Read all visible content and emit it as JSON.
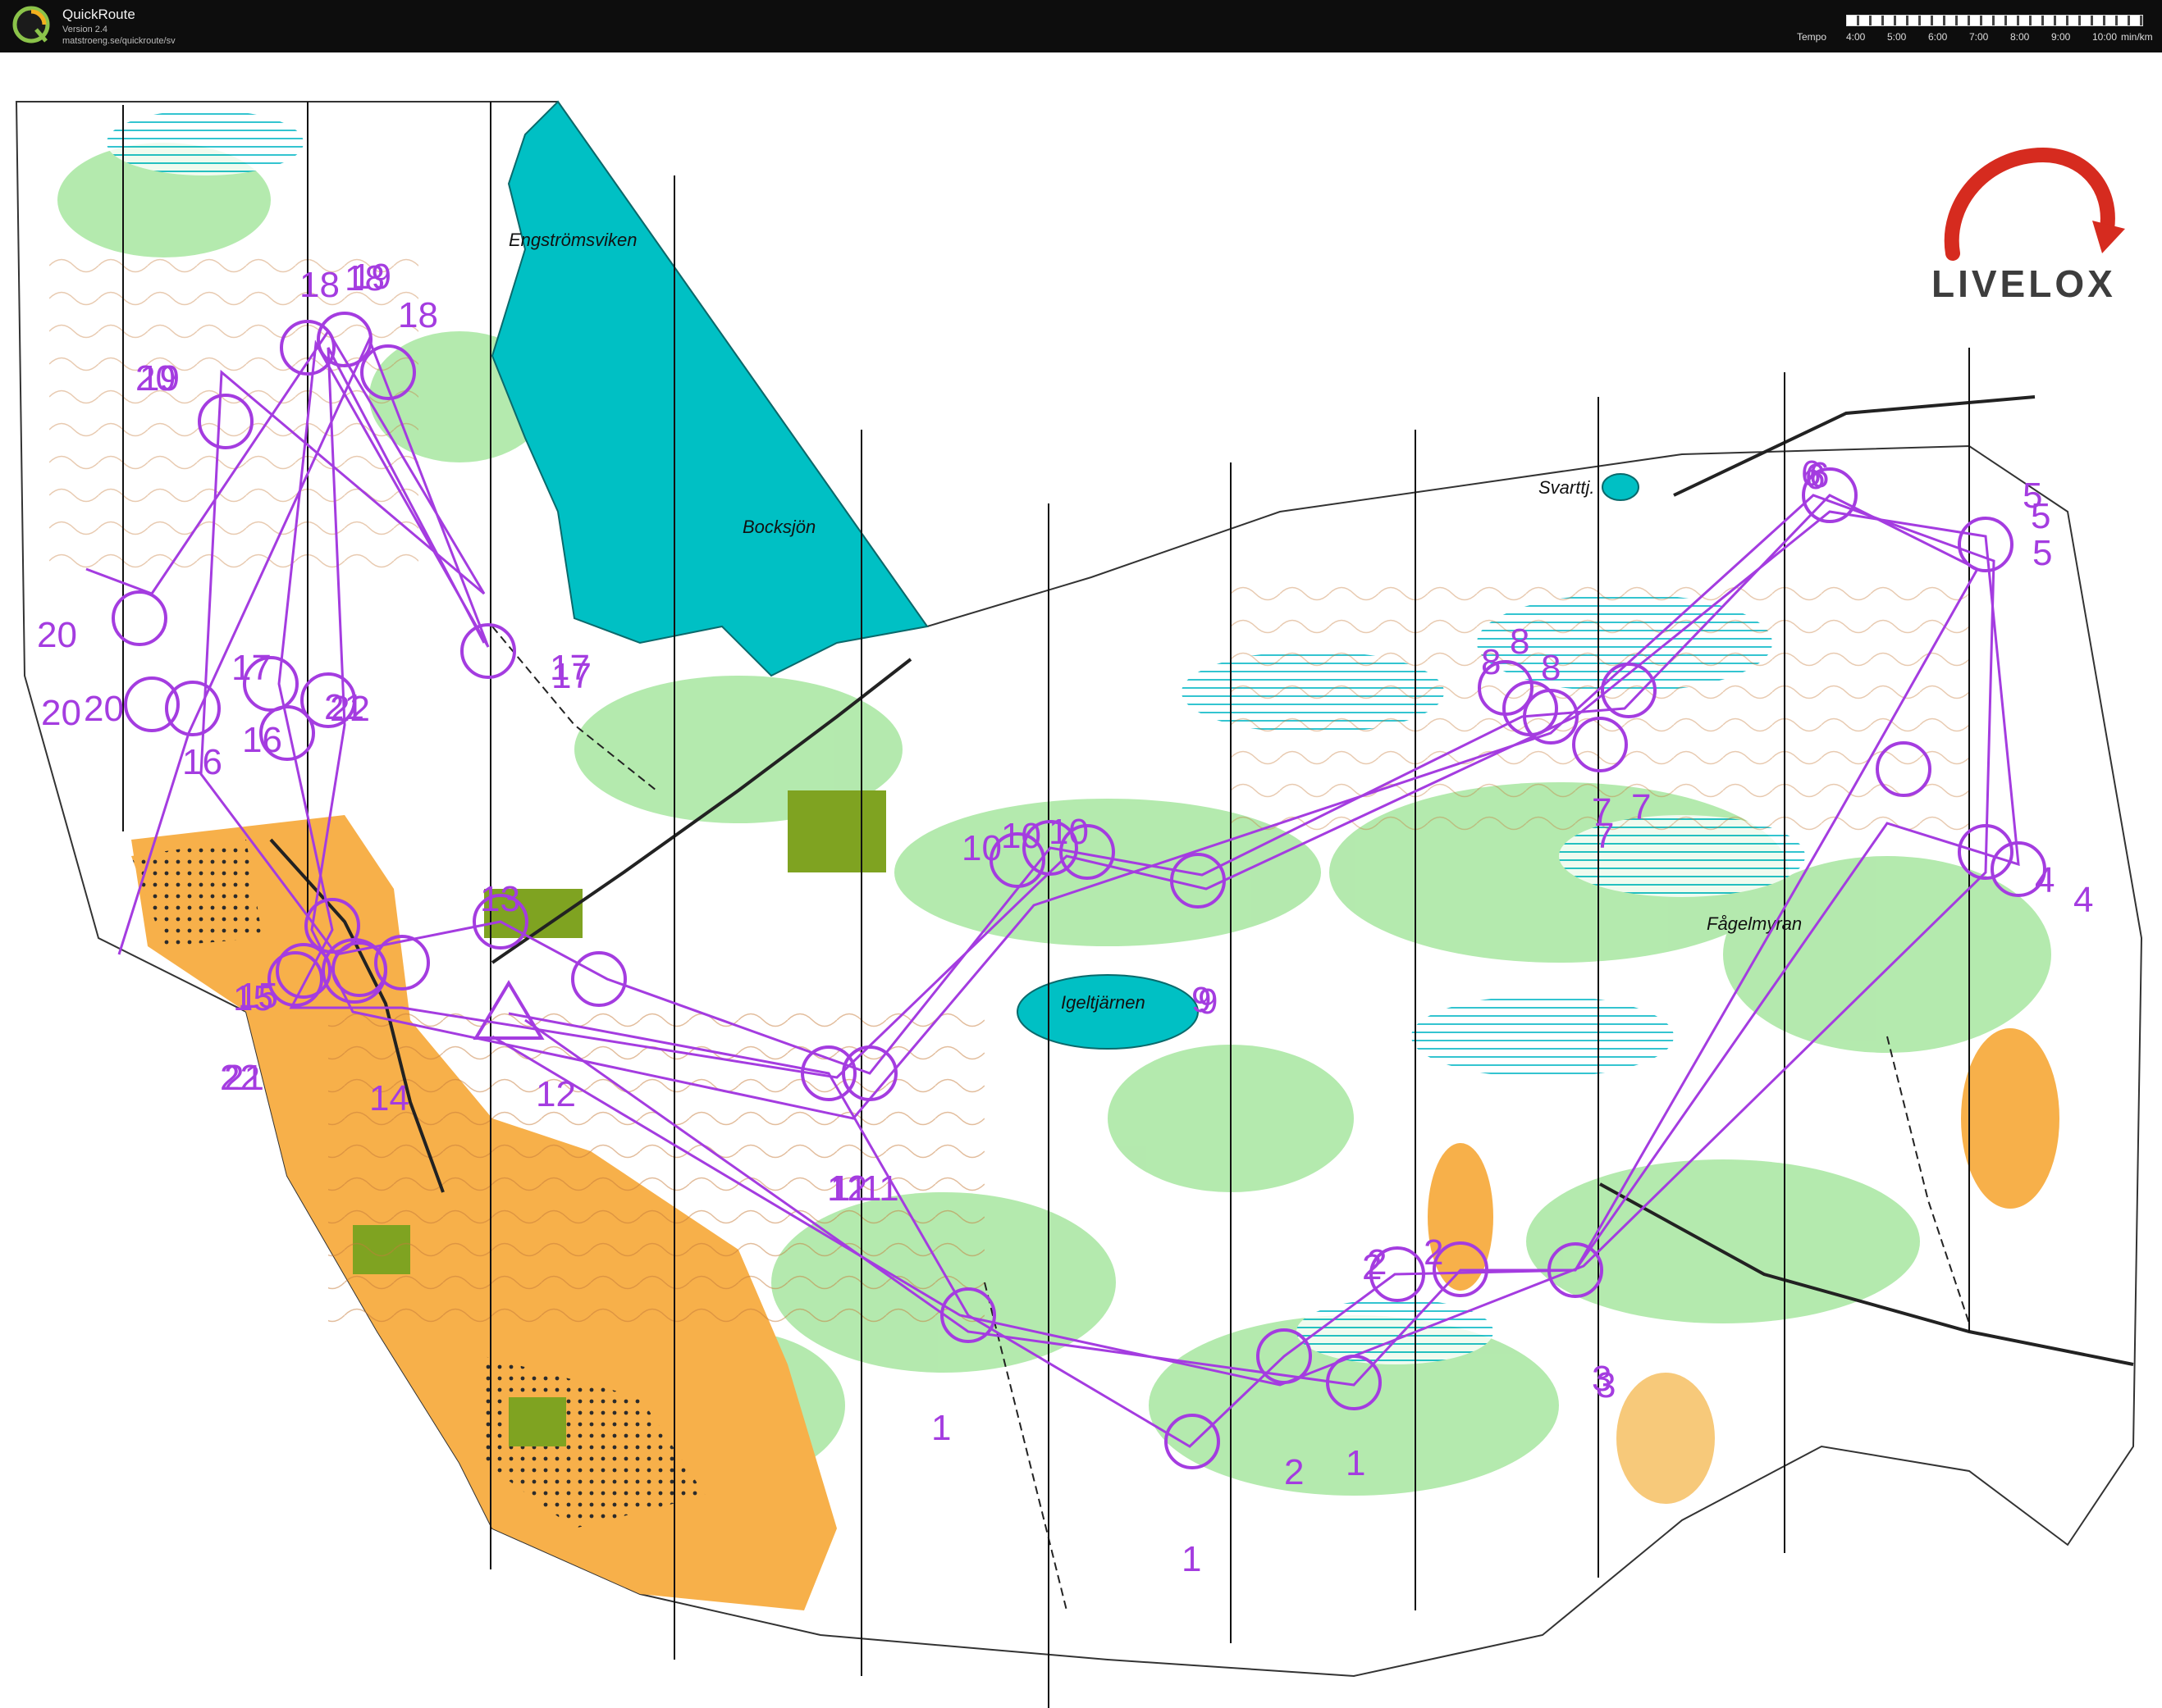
{
  "app": {
    "name": "QuickRoute",
    "version": "Version 2.4",
    "url": "matstroeng.se/quickroute/sv"
  },
  "tempo": {
    "label": "Tempo",
    "ticks": [
      "4:00",
      "5:00",
      "6:00",
      "7:00",
      "8:00",
      "9:00",
      "10:00",
      "min/km"
    ]
  },
  "brand": {
    "name": "LIVELOX",
    "accent": "#d62b1f"
  },
  "colors": {
    "water": "#00c0c4",
    "open_land": "#f7b04a",
    "forest_green": "#9fe39a",
    "course": "#a43ce0"
  },
  "map_labels": {
    "engstromsviken": "Engströmsviken",
    "bocksjon": "Bocksjön",
    "svarttj": "Svarttj.",
    "igeltjarnen": "Igeltjärnen",
    "fagelmyran": "Fågelmyran"
  },
  "control_numbers": [
    "1",
    "1",
    "1",
    "2",
    "2",
    "2",
    "2",
    "3",
    "3",
    "4",
    "4",
    "5",
    "5",
    "5",
    "6",
    "6",
    "6",
    "7",
    "7",
    "7",
    "8",
    "8",
    "8",
    "9",
    "9",
    "10",
    "10",
    "10",
    "11",
    "11",
    "12",
    "12",
    "13",
    "14",
    "15",
    "15",
    "16",
    "16",
    "17",
    "17",
    "17",
    "18",
    "18",
    "18",
    "19",
    "19",
    "20",
    "20",
    "20",
    "20",
    "21",
    "21",
    "22",
    "22"
  ]
}
